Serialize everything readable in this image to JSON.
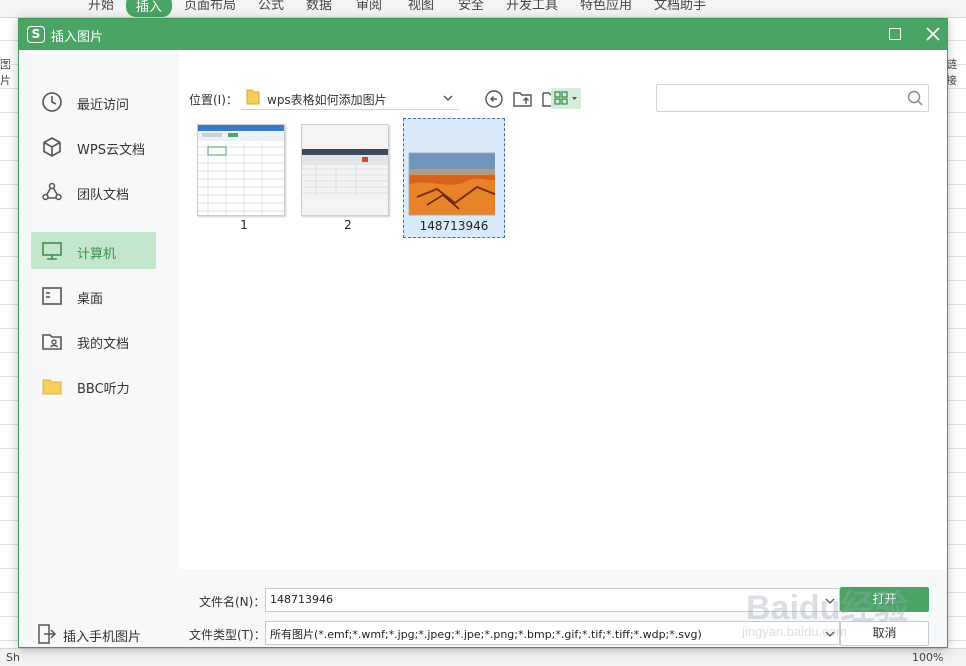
{
  "app": {
    "ribbon_tabs": [
      "开始",
      "插入",
      "页面布局",
      "公式",
      "数据",
      "审阅",
      "视图",
      "安全",
      "开发工具",
      "特色应用",
      "文档助手"
    ],
    "active_tab": "插入",
    "left_labels": [
      "图片"
    ],
    "right_labels": [
      "链接"
    ],
    "status_left": "Sh",
    "zoom": "100%"
  },
  "dialog": {
    "title": "插入图片",
    "logo_letter": "S",
    "sidebar": {
      "items": [
        {
          "label": "最近访问",
          "icon": "clock-icon"
        },
        {
          "label": "WPS云文档",
          "icon": "cube-icon"
        },
        {
          "label": "团队文档",
          "icon": "team-icon"
        },
        {
          "label": "计算机",
          "icon": "monitor-icon"
        },
        {
          "label": "桌面",
          "icon": "desktop-icon"
        },
        {
          "label": "我的文档",
          "icon": "my-documents-icon"
        },
        {
          "label": "BBC听力",
          "icon": "folder-icon"
        }
      ],
      "active_index": 3,
      "insert_phone_label": "插入手机图片"
    },
    "location": {
      "label": "位置(I)：",
      "path": "wps表格如何添加图片"
    },
    "search": {
      "placeholder": ""
    },
    "files": [
      {
        "name": "1",
        "kind": "spreadsheet"
      },
      {
        "name": "2",
        "kind": "spreadsheet"
      },
      {
        "name": "148713946",
        "kind": "desert-photo",
        "selected": true
      }
    ],
    "footer": {
      "filename_label": "文件名(N)：",
      "filename_value": "148713946",
      "filetype_label": "文件类型(T)：",
      "filetype_value": "所有图片(*.emf;*.wmf;*.jpg;*.jpeg;*.jpe;*.png;*.bmp;*.gif;*.tif;*.tiff;*.wdp;*.svg)",
      "open_label": "打开",
      "cancel_label": "取消"
    }
  },
  "watermark": {
    "text": "Baidu经验",
    "url": "jingyan.baidu.com"
  },
  "colors": {
    "accent": "#4aa564",
    "active_nav_bg": "#c4e6cd",
    "selected_file_bg": "#d9eafb"
  }
}
